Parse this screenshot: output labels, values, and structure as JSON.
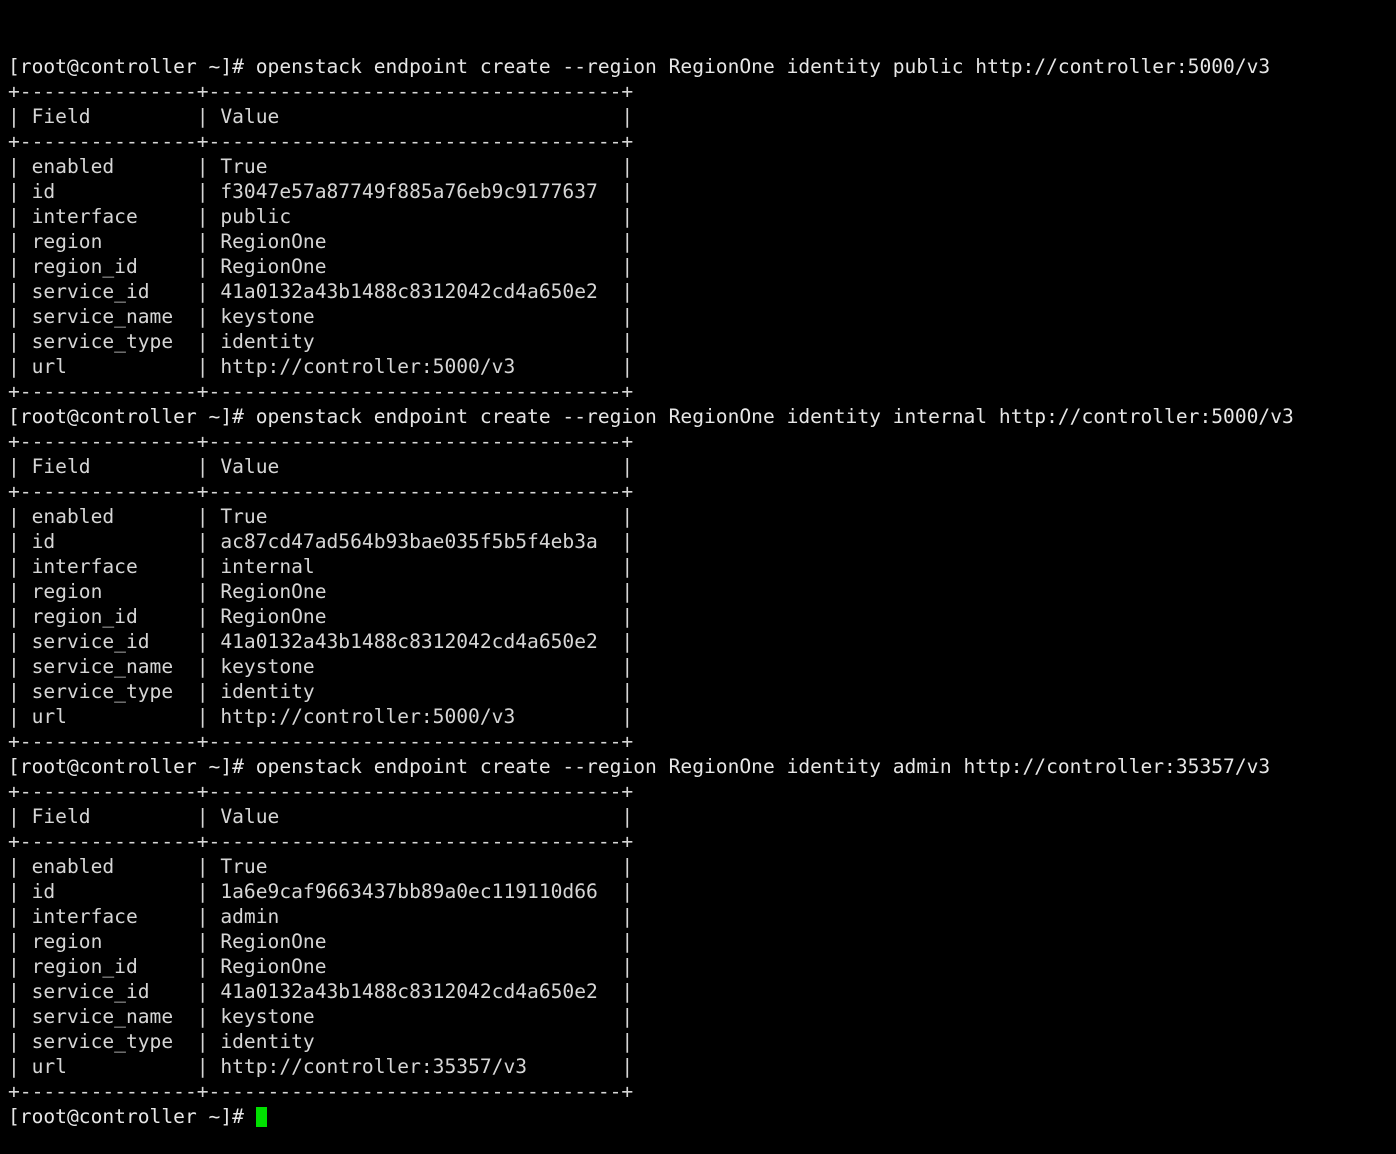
{
  "terminal": {
    "title": "root@controller:~",
    "background_color": "#000000",
    "text_color": "#d6d6d6",
    "cursor_color": "#00e000",
    "prompt": "[root@controller ~]# ",
    "font_size_px": 19.6,
    "line_height_px": 25,
    "columns": 114,
    "rows": 44
  },
  "table_format": {
    "top_border": "+---------------+-----------------------------------+",
    "header_separator": "+---------------+-----------------------------------+",
    "bottom_border": "+---------------+-----------------------------------+",
    "header_row": "| Field         | Value                             |",
    "col1_header": "Field",
    "col2_header": "Value",
    "col1_width": 15,
    "col2_width": 35
  },
  "session": {
    "blocks": [
      {
        "command": "openstack endpoint create --region RegionOne identity public http://controller:5000/v3",
        "command_line": "[root@controller ~]# openstack endpoint create --region RegionOne identity public http://controller:5000/v3",
        "rows": [
          {
            "field": "enabled",
            "value": "True",
            "line": "| enabled       | True                              |"
          },
          {
            "field": "id",
            "value": "f3047e57a87749f885a76eb9c9177637",
            "line": "| id            | f3047e57a87749f885a76eb9c9177637  |"
          },
          {
            "field": "interface",
            "value": "public",
            "line": "| interface     | public                            |"
          },
          {
            "field": "region",
            "value": "RegionOne",
            "line": "| region        | RegionOne                         |"
          },
          {
            "field": "region_id",
            "value": "RegionOne",
            "line": "| region_id     | RegionOne                         |"
          },
          {
            "field": "service_id",
            "value": "41a0132a43b1488c8312042cd4a650e2",
            "line": "| service_id    | 41a0132a43b1488c8312042cd4a650e2  |"
          },
          {
            "field": "service_name",
            "value": "keystone",
            "line": "| service_name  | keystone                          |"
          },
          {
            "field": "service_type",
            "value": "identity",
            "line": "| service_type  | identity                          |"
          },
          {
            "field": "url",
            "value": "http://controller:5000/v3",
            "line": "| url           | http://controller:5000/v3         |"
          }
        ]
      },
      {
        "command": "openstack endpoint create --region RegionOne identity internal http://controller:5000/v3",
        "command_line": "[root@controller ~]# openstack endpoint create --region RegionOne identity internal http://controller:5000/v3",
        "rows": [
          {
            "field": "enabled",
            "value": "True",
            "line": "| enabled       | True                              |"
          },
          {
            "field": "id",
            "value": "ac87cd47ad564b93bae035f5b5f4eb3a",
            "line": "| id            | ac87cd47ad564b93bae035f5b5f4eb3a  |"
          },
          {
            "field": "interface",
            "value": "internal",
            "line": "| interface     | internal                          |"
          },
          {
            "field": "region",
            "value": "RegionOne",
            "line": "| region        | RegionOne                         |"
          },
          {
            "field": "region_id",
            "value": "RegionOne",
            "line": "| region_id     | RegionOne                         |"
          },
          {
            "field": "service_id",
            "value": "41a0132a43b1488c8312042cd4a650e2",
            "line": "| service_id    | 41a0132a43b1488c8312042cd4a650e2  |"
          },
          {
            "field": "service_name",
            "value": "keystone",
            "line": "| service_name  | keystone                          |"
          },
          {
            "field": "service_type",
            "value": "identity",
            "line": "| service_type  | identity                          |"
          },
          {
            "field": "url",
            "value": "http://controller:5000/v3",
            "line": "| url           | http://controller:5000/v3         |"
          }
        ]
      },
      {
        "command": "openstack endpoint create --region RegionOne identity admin http://controller:35357/v3",
        "command_line": "[root@controller ~]# openstack endpoint create --region RegionOne identity admin http://controller:35357/v3",
        "rows": [
          {
            "field": "enabled",
            "value": "True",
            "line": "| enabled       | True                              |"
          },
          {
            "field": "id",
            "value": "1a6e9caf9663437bb89a0ec119110d66",
            "line": "| id            | 1a6e9caf9663437bb89a0ec119110d66  |"
          },
          {
            "field": "interface",
            "value": "admin",
            "line": "| interface     | admin                             |"
          },
          {
            "field": "region",
            "value": "RegionOne",
            "line": "| region        | RegionOne                         |"
          },
          {
            "field": "region_id",
            "value": "RegionOne",
            "line": "| region_id     | RegionOne                         |"
          },
          {
            "field": "service_id",
            "value": "41a0132a43b1488c8312042cd4a650e2",
            "line": "| service_id    | 41a0132a43b1488c8312042cd4a650e2  |"
          },
          {
            "field": "service_name",
            "value": "keystone",
            "line": "| service_name  | keystone                          |"
          },
          {
            "field": "service_type",
            "value": "identity",
            "line": "| service_type  | identity                          |"
          },
          {
            "field": "url",
            "value": "http://controller:35357/v3",
            "line": "| url           | http://controller:35357/v3        |"
          }
        ]
      }
    ],
    "final_prompt": "[root@controller ~]# "
  }
}
